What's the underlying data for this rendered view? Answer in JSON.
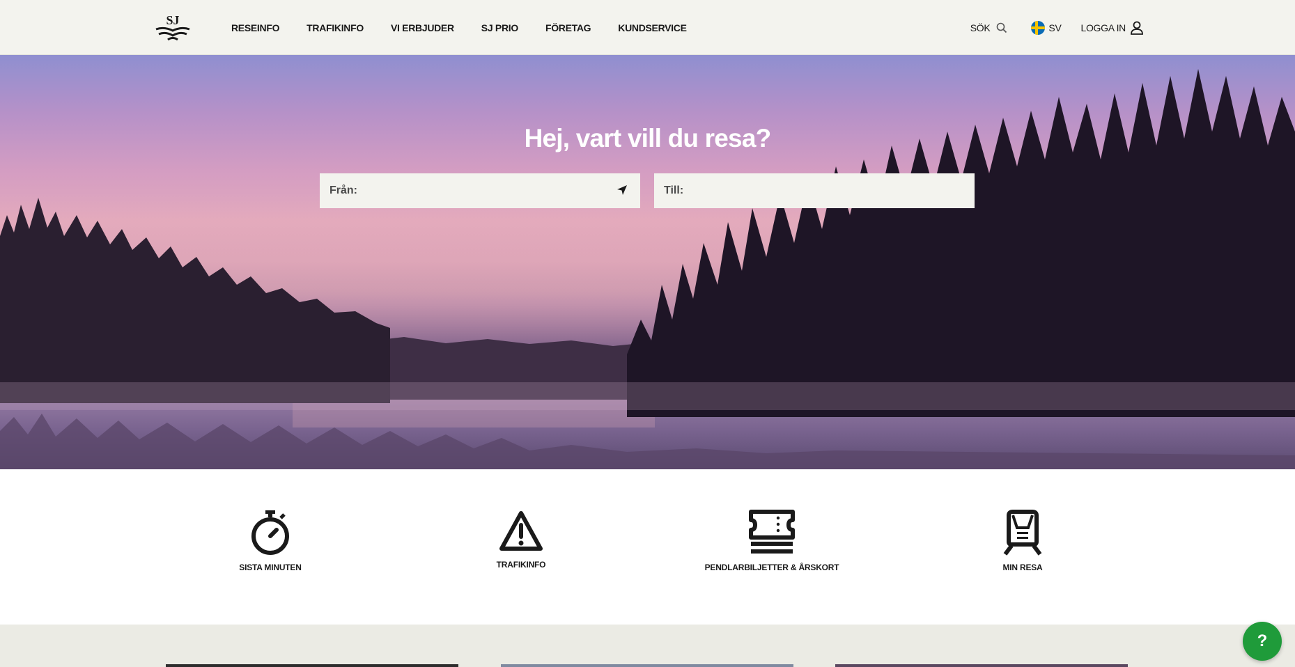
{
  "header": {
    "logo_text": "SJ",
    "nav": [
      {
        "label": "RESEINFO"
      },
      {
        "label": "TRAFIKINFO"
      },
      {
        "label": "VI ERBJUDER"
      },
      {
        "label": "SJ PRIO"
      },
      {
        "label": "FÖRETAG"
      },
      {
        "label": "KUNDSERVICE"
      }
    ],
    "search_label": "SÖK",
    "search_icon": "search-icon",
    "language_label": "SV",
    "language_flag": "swedish-flag-icon",
    "login_label": "LOGGA IN",
    "login_icon": "user-icon"
  },
  "hero": {
    "title": "Hej, vart vill du resa?",
    "from_label": "Från:",
    "to_label": "Till:",
    "locate_icon": "location-arrow-icon"
  },
  "shortcuts": [
    {
      "label": "SISTA MINUTEN",
      "icon": "stopwatch-icon"
    },
    {
      "label": "TRAFIKINFO",
      "icon": "warning-triangle-icon"
    },
    {
      "label": "PENDLARBILJETTER & ÅRSKORT",
      "icon": "ticket-stack-icon"
    },
    {
      "label": "MIN RESA",
      "icon": "train-icon"
    }
  ],
  "help_button": {
    "label": "?"
  },
  "colors": {
    "header_bg": "#f3f3ee",
    "help_green": "#1f9b3a",
    "text_dark": "#1a1a1a",
    "band_bg": "#ebebe4"
  }
}
